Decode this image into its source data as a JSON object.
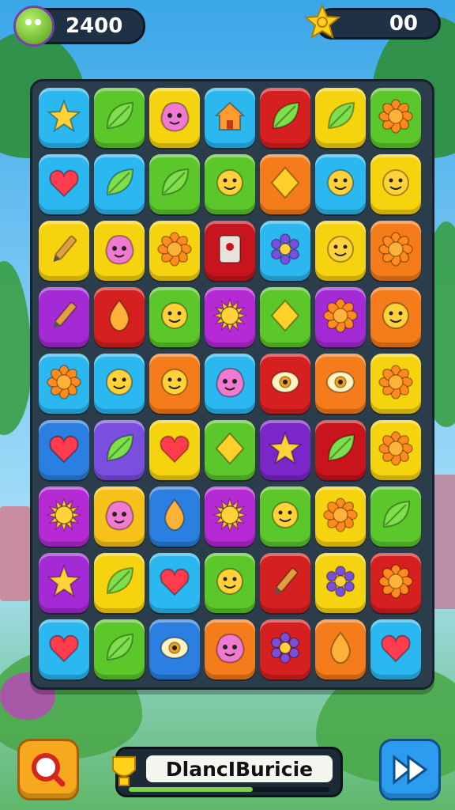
{
  "hud": {
    "score": "2400",
    "stars": "00",
    "avatar_icon": "frog-avatar-icon",
    "star_icon": "star-swirl-icon"
  },
  "board": {
    "rows": [
      [
        {
          "color": "#2bb8f0",
          "icon": "star"
        },
        {
          "color": "#5cc72b",
          "icon": "leaf"
        },
        {
          "color": "#f6d30f",
          "icon": "blob-face"
        },
        {
          "color": "#2bb8f0",
          "icon": "house"
        },
        {
          "color": "#d61f1f",
          "icon": "leaf"
        },
        {
          "color": "#f6d30f",
          "icon": "leaf"
        },
        {
          "color": "#5cc72b",
          "icon": "flower"
        }
      ],
      [
        {
          "color": "#2bb8f0",
          "icon": "heart"
        },
        {
          "color": "#2bb8f0",
          "icon": "leaf"
        },
        {
          "color": "#5cc72b",
          "icon": "leaf"
        },
        {
          "color": "#5cc72b",
          "icon": "smiley"
        },
        {
          "color": "#f57c1a",
          "icon": "diamond"
        },
        {
          "color": "#2bb8f0",
          "icon": "smiley"
        },
        {
          "color": "#f6d30f",
          "icon": "smiley"
        }
      ],
      [
        {
          "color": "#f6d30f",
          "icon": "pencil"
        },
        {
          "color": "#f6d30f",
          "icon": "blob-face"
        },
        {
          "color": "#f6d30f",
          "icon": "flower"
        },
        {
          "color": "#c8141d",
          "icon": "tag"
        },
        {
          "color": "#2bb8f0",
          "icon": "gear-flower"
        },
        {
          "color": "#f6d30f",
          "icon": "smiley"
        },
        {
          "color": "#f57c1a",
          "icon": "flower"
        }
      ],
      [
        {
          "color": "#a42ad6",
          "icon": "pencil"
        },
        {
          "color": "#d61f1f",
          "icon": "drop"
        },
        {
          "color": "#5cc72b",
          "icon": "smiley"
        },
        {
          "color": "#b62ad6",
          "icon": "sun"
        },
        {
          "color": "#5cc72b",
          "icon": "diamond"
        },
        {
          "color": "#a42ad6",
          "icon": "flower"
        },
        {
          "color": "#f57c1a",
          "icon": "smiley"
        }
      ],
      [
        {
          "color": "#2bb8f0",
          "icon": "flower"
        },
        {
          "color": "#2bb8f0",
          "icon": "smiley"
        },
        {
          "color": "#f57c1a",
          "icon": "smiley"
        },
        {
          "color": "#2bb8f0",
          "icon": "blob-face"
        },
        {
          "color": "#d61f1f",
          "icon": "eye"
        },
        {
          "color": "#f57c1a",
          "icon": "eye"
        },
        {
          "color": "#f6d30f",
          "icon": "flower"
        }
      ],
      [
        {
          "color": "#2b7fe0",
          "icon": "heart"
        },
        {
          "color": "#7a4fe0",
          "icon": "leaf"
        },
        {
          "color": "#f6d30f",
          "icon": "heart"
        },
        {
          "color": "#5cc72b",
          "icon": "diamond"
        },
        {
          "color": "#7a26c9",
          "icon": "star"
        },
        {
          "color": "#c8141d",
          "icon": "leaf"
        },
        {
          "color": "#f6d30f",
          "icon": "flower"
        }
      ],
      [
        {
          "color": "#b62ad6",
          "icon": "sun"
        },
        {
          "color": "#f6c21a",
          "icon": "blob-face"
        },
        {
          "color": "#2b7fe0",
          "icon": "drop"
        },
        {
          "color": "#b62ad6",
          "icon": "sun"
        },
        {
          "color": "#5cc72b",
          "icon": "smiley"
        },
        {
          "color": "#f6d30f",
          "icon": "flower"
        },
        {
          "color": "#5cc72b",
          "icon": "leaf"
        }
      ],
      [
        {
          "color": "#a42ad6",
          "icon": "star"
        },
        {
          "color": "#f6d30f",
          "icon": "leaf"
        },
        {
          "color": "#2bb8f0",
          "icon": "heart"
        },
        {
          "color": "#5cc72b",
          "icon": "smiley"
        },
        {
          "color": "#d61f1f",
          "icon": "pencil"
        },
        {
          "color": "#f6d30f",
          "icon": "gear-flower"
        },
        {
          "color": "#d61f1f",
          "icon": "flower"
        }
      ],
      [
        {
          "color": "#2bb8f0",
          "icon": "heart"
        },
        {
          "color": "#5cc72b",
          "icon": "leaf"
        },
        {
          "color": "#2b7fe0",
          "icon": "eye"
        },
        {
          "color": "#f57c1a",
          "icon": "blob-face"
        },
        {
          "color": "#d61f1f",
          "icon": "gear-flower"
        },
        {
          "color": "#f57c1a",
          "icon": "drop"
        },
        {
          "color": "#2bb8f0",
          "icon": "heart"
        }
      ]
    ]
  },
  "footer": {
    "status_text": "DlancIBuricie",
    "progress": 0.62,
    "left_button_icon": "magnifier-icon",
    "right_button_icon": "fast-forward-icon",
    "status_icon": "trophy-badge-icon"
  }
}
